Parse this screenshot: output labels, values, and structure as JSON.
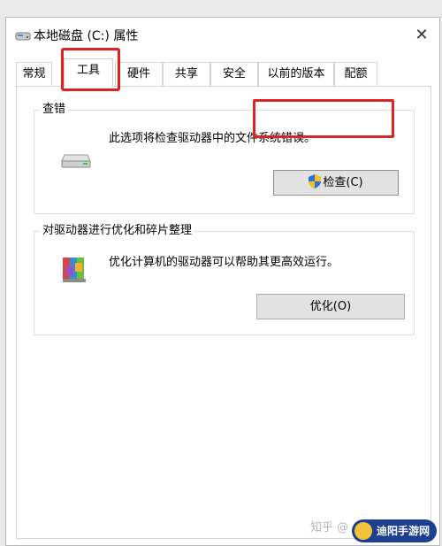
{
  "window": {
    "title": "本地磁盘 (C:) 属性",
    "close_glyph": "✕"
  },
  "tabs": [
    {
      "label": "常规",
      "active": false
    },
    {
      "label": "工具",
      "active": true
    },
    {
      "label": "硬件",
      "active": false
    },
    {
      "label": "共享",
      "active": false
    },
    {
      "label": "安全",
      "active": false
    },
    {
      "label": "以前的版本",
      "active": false
    },
    {
      "label": "配额",
      "active": false
    }
  ],
  "error_check": {
    "group_label": "查错",
    "description": "此选项将检查驱动器中的文件系统错误。",
    "button_label": "检查(C)",
    "icon": "drive-icon",
    "button_icon": "uac-shield-icon"
  },
  "optimize": {
    "group_label": "对驱动器进行优化和碎片整理",
    "description": "优化计算机的驱动器可以帮助其更高效运行。",
    "button_label": "优化(O)",
    "icon": "defrag-icon"
  },
  "watermark": {
    "text": "知乎 @",
    "logo_text": "迪阳手游网"
  },
  "colors": {
    "highlight": "#e02020",
    "button_bg": "#e2e2e2",
    "window_bg": "#ffffff"
  }
}
